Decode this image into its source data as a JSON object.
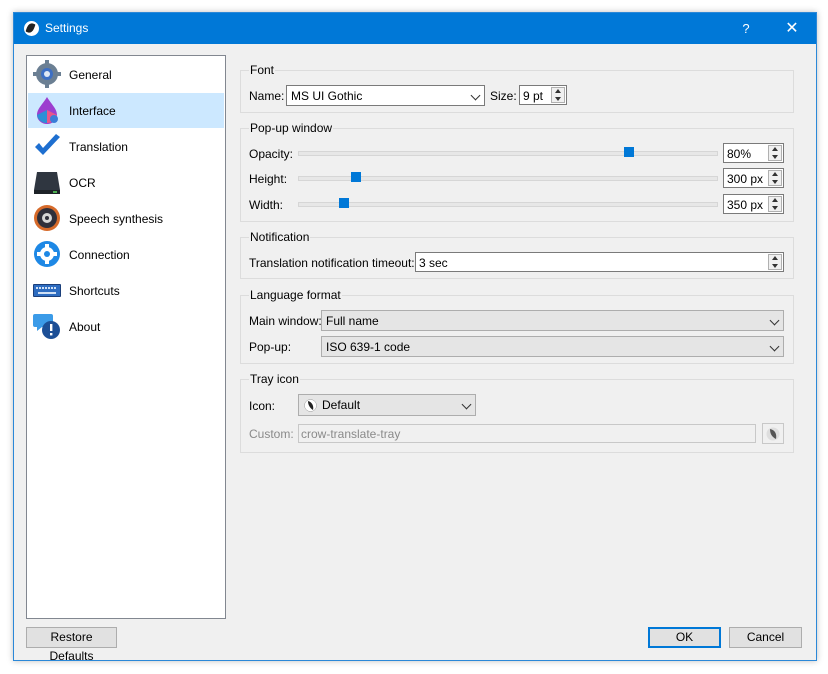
{
  "window": {
    "title": "Settings",
    "help": "?",
    "close": "✕"
  },
  "sidebar": {
    "items": [
      {
        "label": "General",
        "icon": "gear-icon"
      },
      {
        "label": "Interface",
        "icon": "paint-drop-icon",
        "selected": true
      },
      {
        "label": "Translation",
        "icon": "checkmark-icon"
      },
      {
        "label": "OCR",
        "icon": "scanner-icon"
      },
      {
        "label": "Speech synthesis",
        "icon": "speaker-icon"
      },
      {
        "label": "Connection",
        "icon": "network-gear-icon"
      },
      {
        "label": "Shortcuts",
        "icon": "keyboard-icon"
      },
      {
        "label": "About",
        "icon": "info-bubble-icon"
      }
    ]
  },
  "font": {
    "title": "Font",
    "name_label": "Name:",
    "name_value": "MS UI Gothic",
    "size_label": "Size:",
    "size_value": "9 pt"
  },
  "popup": {
    "title": "Pop-up window",
    "opacity_label": "Opacity:",
    "opacity_value": "80%",
    "opacity_level": 0.8,
    "height_label": "Height:",
    "height_value": "300 px",
    "height_level": 0.13,
    "width_label": "Width:",
    "width_value": "350 px",
    "width_level": 0.1
  },
  "notification": {
    "title": "Notification",
    "timeout_label": "Translation notification timeout:",
    "timeout_value": "3 sec"
  },
  "language_format": {
    "title": "Language format",
    "main_label": "Main window:",
    "main_value": "Full name",
    "popup_label": "Pop-up:",
    "popup_value": "ISO 639-1 code"
  },
  "tray": {
    "title": "Tray icon",
    "icon_label": "Icon:",
    "icon_value": "Default",
    "custom_label": "Custom:",
    "custom_value": "crow-translate-tray"
  },
  "buttons": {
    "restore": "Restore Defaults",
    "ok": "OK",
    "cancel": "Cancel"
  },
  "colors": {
    "accent": "#0078d7",
    "selection": "#cce8ff"
  }
}
